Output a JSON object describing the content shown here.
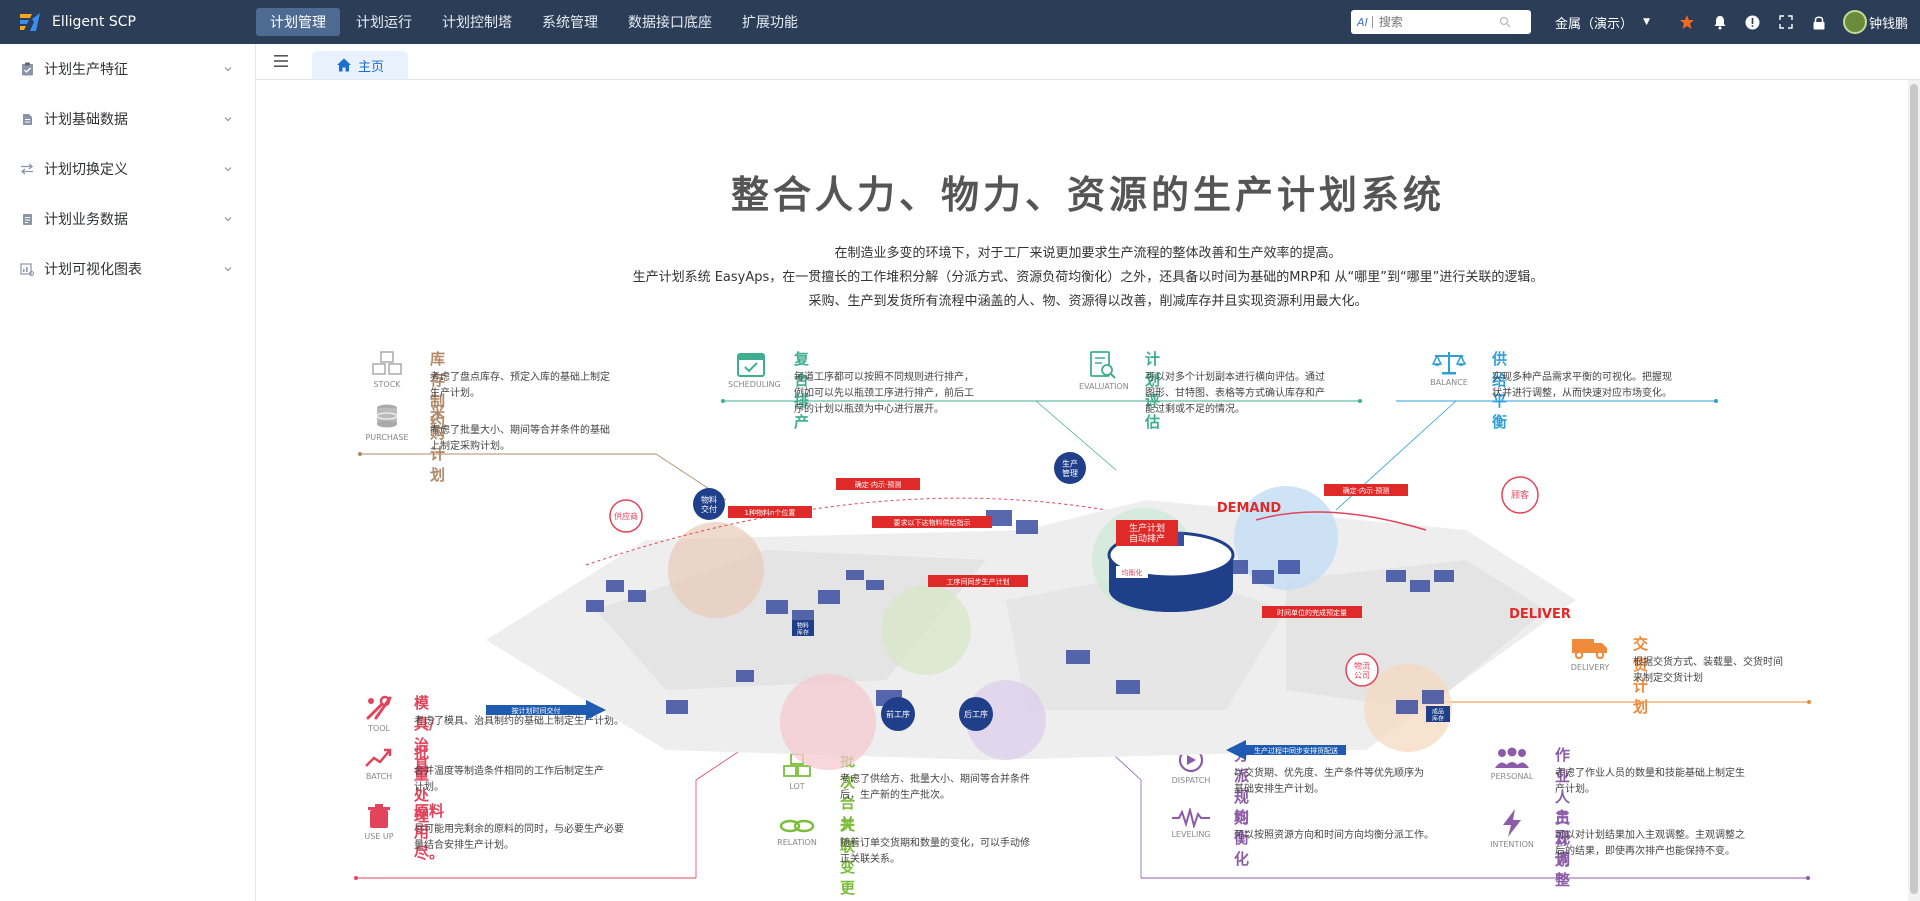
{
  "app": {
    "name": "Elligent SCP"
  },
  "topnav": [
    {
      "label": "计划管理",
      "active": true
    },
    {
      "label": "计划运行",
      "active": false
    },
    {
      "label": "计划控制塔",
      "active": false
    },
    {
      "label": "系统管理",
      "active": false
    },
    {
      "label": "数据接口底座",
      "active": false
    },
    {
      "label": "扩展功能",
      "active": false
    }
  ],
  "search": {
    "ai_label": "AI",
    "placeholder": "搜索"
  },
  "company": {
    "label": "金属（演示）"
  },
  "user": {
    "name": "钟钱鹏"
  },
  "sidebar": {
    "items": [
      {
        "label": "计划生产特征",
        "icon": "clipboard-icon"
      },
      {
        "label": "计划基础数据",
        "icon": "file-icon"
      },
      {
        "label": "计划切换定义",
        "icon": "swap-icon"
      },
      {
        "label": "计划业务数据",
        "icon": "document-icon"
      },
      {
        "label": "计划可视化图表",
        "icon": "chart-icon"
      }
    ]
  },
  "tabs": [
    {
      "label": "主页",
      "active": true
    }
  ],
  "page": {
    "title": "整合人力、物力、资源的生产计划系统",
    "intro": [
      "在制造业多变的环境下，对于工厂来说更加要求生产流程的整体改善和生产效率的提高。",
      "生产计划系统 EasyAps，在一贯擅长的工作堆积分解（分派方式、资源负荷均衡化）之外，还具备以时间为基础的MRP和 从“哪里”到“哪里”进行关联的逻辑。",
      "采购、生产到发货所有流程中涵盖的人、物、资源得以改善，削减库存并且实现资源利用最大化。"
    ],
    "features": [
      {
        "key": "stock",
        "title": "库存制约",
        "label": "STOCK",
        "color": "#b08a6a",
        "desc": [
          "考虑了盘点库存、预定入库的基础上制定",
          "生产计划。"
        ]
      },
      {
        "key": "purchase",
        "title": "采购计划",
        "label": "PURCHASE",
        "color": "#b08a6a",
        "desc": [
          "考虑了批量大小、期间等合并条件的基础",
          "上制定采购计划。"
        ]
      },
      {
        "key": "scheduling",
        "title": "复合排产",
        "label": "SCHEDULING",
        "color": "#3fae8e",
        "desc": [
          "每道工序都可以按照不同规则进行排产，",
          "例如可以先以瓶颈工序进行排产，前后工",
          "序的计划以瓶颈为中心进行展开。"
        ]
      },
      {
        "key": "evaluation",
        "title": "计划评估",
        "label": "EVALUATION",
        "color": "#3fae8e",
        "desc": [
          "可以对多个计划副本进行横向评估。通过",
          "图形、甘特图、表格等方式确认库存和产",
          "能过剩或不足的情况。"
        ]
      },
      {
        "key": "balance",
        "title": "供给平衡",
        "label": "BALANCE",
        "color": "#2f9fd8",
        "desc": [
          "实现多种产品需求平衡的可视化。把握现",
          "状并进行调整，从而快速对应市场变化。"
        ]
      },
      {
        "key": "delivery",
        "title": "交货计划",
        "label": "DELIVERY",
        "color": "#ef8a3a",
        "desc": [
          "根据交货方式、装载量、交货时间",
          "来制定交货计划"
        ]
      },
      {
        "key": "tool",
        "title": "模具/治具",
        "label": "TOOL",
        "color": "#e2445c",
        "desc": [
          "考虑了模具、治具制约的基础上制定生产计划。"
        ]
      },
      {
        "key": "batch",
        "title": "批量处理",
        "label": "BATCH",
        "color": "#e2445c",
        "desc": [
          "合并温度等制造条件相同的工作后制定生产",
          "计划。"
        ]
      },
      {
        "key": "useup",
        "title": "原料用尽。",
        "label": "USE UP",
        "color": "#e2445c",
        "desc": [
          "尽可能用完剩余的原料的同时，与必要生产必要",
          "量结合安排生产计划。"
        ]
      },
      {
        "key": "lot",
        "title": "批次合并",
        "label": "LOT",
        "color": "#7dbd3c",
        "desc": [
          "考虑了供给方、批量大小、期间等合并条件",
          "后，生产新的生产批次。"
        ]
      },
      {
        "key": "relation",
        "title": "关联变更",
        "label": "RELATION",
        "color": "#7dbd3c",
        "desc": [
          "随着订单交货期和数量的变化，可以手动修",
          "正关联关系。"
        ]
      },
      {
        "key": "dispatch",
        "title": "分派规则",
        "label": "DISPATCH",
        "color": "#8c5ca8",
        "desc": [
          "以交货期、优先度、生产条件等优先顺序为",
          "基础安排生产计划。"
        ]
      },
      {
        "key": "personal",
        "title": "作业人员计划",
        "label": "PERSONAL",
        "color": "#8c5ca8",
        "desc": [
          "考虑了作业人员的数量和技能基础上制定生",
          "产计划。"
        ]
      },
      {
        "key": "leveling",
        "title": "均衡化",
        "label": "LEVELING",
        "color": "#8c5ca8",
        "desc": [
          "可以按照资源方向和时间方向均衡分派工作。"
        ]
      },
      {
        "key": "intention",
        "title": "主观调整",
        "label": "INTENTION",
        "color": "#8c5ca8",
        "desc": [
          "可以对计划结果加入主观调整。主观调整之",
          "后的结果，即使再次排产也能保持不变。"
        ]
      }
    ],
    "diagram": {
      "labels": {
        "demand": "DEMAND",
        "deliver": "DELIVER",
        "customer": "顾客",
        "center": "生产计划\n自动排产",
        "balance_hub": "均衡化",
        "supplier": "供应商",
        "material_delivery": "物料\n交付",
        "production_mgmt": "生产\n管理",
        "material_inventory": "物料\n库存",
        "pre_process": "前工序",
        "post_process": "后工序",
        "logistics_warehouse": "物流\n公司",
        "finished_inventory": "成品\n库存",
        "tag_confirm": "确定·内示·预测",
        "tag_timing": "1种物料n个位置",
        "tag_request": "要求以下达物料供给指示",
        "tag_sync": "工序间同步生产计划",
        "tag_time_unit": "时间单位的完成预定量",
        "tag_confirm2": "确定·内示·预测",
        "arrow_left": "按计划时间交付",
        "arrow_bottom": "生产过程中同步安排货配送"
      }
    }
  }
}
